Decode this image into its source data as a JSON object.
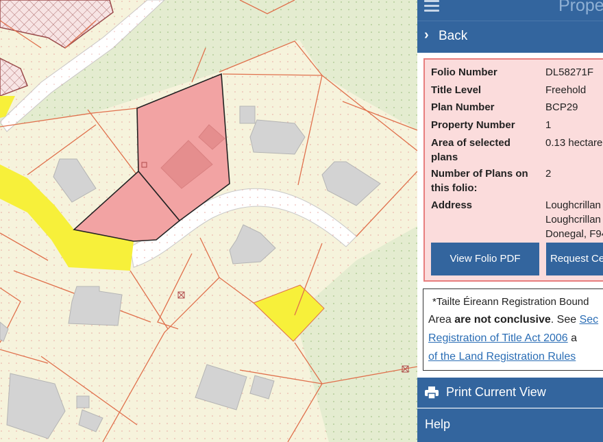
{
  "header": {
    "title": "Prope"
  },
  "nav": {
    "back_label": "Back"
  },
  "property": {
    "fields": [
      {
        "key": "Folio Number",
        "value": "DL58271F"
      },
      {
        "key": "Title Level",
        "value": "Freehold"
      },
      {
        "key": "Plan Number",
        "value": "BCP29"
      },
      {
        "key": "Property Number",
        "value": "1"
      },
      {
        "key": "Area of selected plans",
        "value": "0.13 hectare"
      },
      {
        "key": "Number of Plans on this folio:",
        "value": "2"
      },
      {
        "key": "Address",
        "value": "Loughcrillan"
      }
    ],
    "address_lines": [
      "Loughcrillan",
      "Loughcrillan",
      "Donegal, F94"
    ],
    "buttons": {
      "view_folio": "View Folio PDF",
      "request_cert": "Request Ce"
    }
  },
  "disclaimer": {
    "line1": "*Tailte Éireann Registration Bound",
    "line2_pre": "Area ",
    "line2_bold": "are not conclusive",
    "line2_post": ". See ",
    "line2_link": "Sec",
    "line3_link": "Registration of Title Act 2006",
    "line3_post": " a",
    "line4_link": "of the Land Registration Rules"
  },
  "actions": {
    "print_label": "Print Current View",
    "help_label": "Help"
  },
  "colors": {
    "brand": "#33659e",
    "selected_parcel": "#f2a3a3",
    "highlight_parcel": "#f7f03a",
    "parcel_border": "#e0704c"
  }
}
